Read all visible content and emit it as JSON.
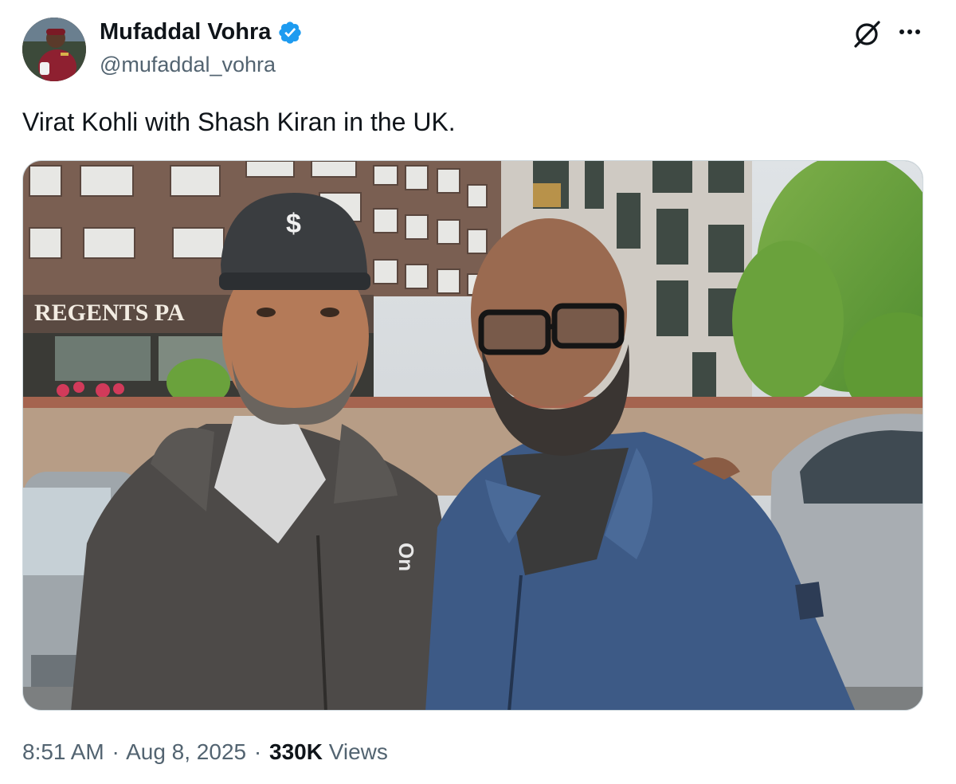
{
  "author": {
    "display_name": "Mufaddal Vohra",
    "handle": "@mufaddal_vohra",
    "verified": true,
    "avatar_icon": "profile-photo"
  },
  "header_actions": {
    "grok_icon": "grok-icon",
    "more_icon": "more-options-icon"
  },
  "tweet": {
    "text": "Virat Kohli with Shash Kiran in the UK."
  },
  "media": {
    "type": "photo",
    "sign_text": "REGENTS PA",
    "cap_logo": "$",
    "hoodie_logo": "On"
  },
  "meta": {
    "time": "8:51 AM",
    "date": "Aug 8, 2025",
    "separator": "·",
    "views_count": "330K",
    "views_label": "Views"
  },
  "colors": {
    "text_primary": "#0f1419",
    "text_secondary": "#536471",
    "verified_blue": "#1d9bf0",
    "border": "#cfd9de"
  }
}
